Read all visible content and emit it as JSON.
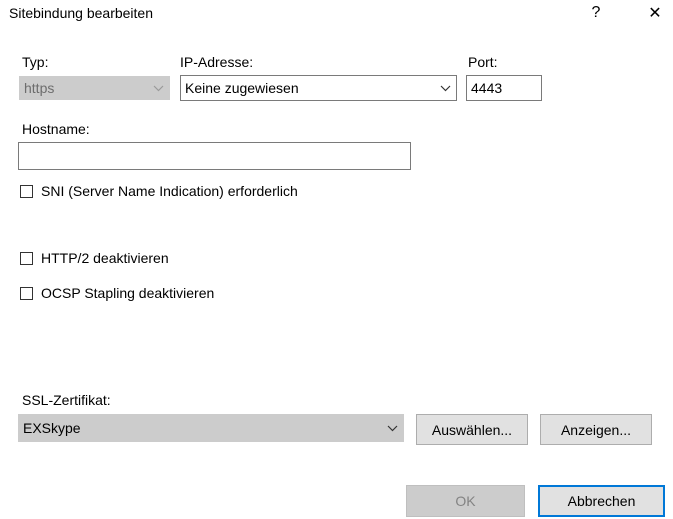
{
  "window": {
    "title": "Sitebindung bearbeiten",
    "help_label": "?",
    "close_label": "✕"
  },
  "form": {
    "type_label": "Typ:",
    "type_value": "https",
    "ip_label": "IP-Adresse:",
    "ip_value": "Keine zugewiesen",
    "port_label": "Port:",
    "port_value": "4443",
    "hostname_label": "Hostname:",
    "hostname_value": "",
    "sni_label": "SNI (Server Name Indication) erforderlich",
    "sni_checked": false,
    "http2_label": "HTTP/2 deaktivieren",
    "http2_checked": false,
    "ocsp_label": "OCSP Stapling deaktivieren",
    "ocsp_checked": false,
    "ssl_label": "SSL-Zertifikat:",
    "ssl_value": "EXSkype"
  },
  "buttons": {
    "select_label": "Auswählen...",
    "view_label": "Anzeigen...",
    "ok_label": "OK",
    "cancel_label": "Abbrechen"
  },
  "colors": {
    "default_button_border": "#0078d7",
    "disabled_bg": "#cccccc"
  }
}
